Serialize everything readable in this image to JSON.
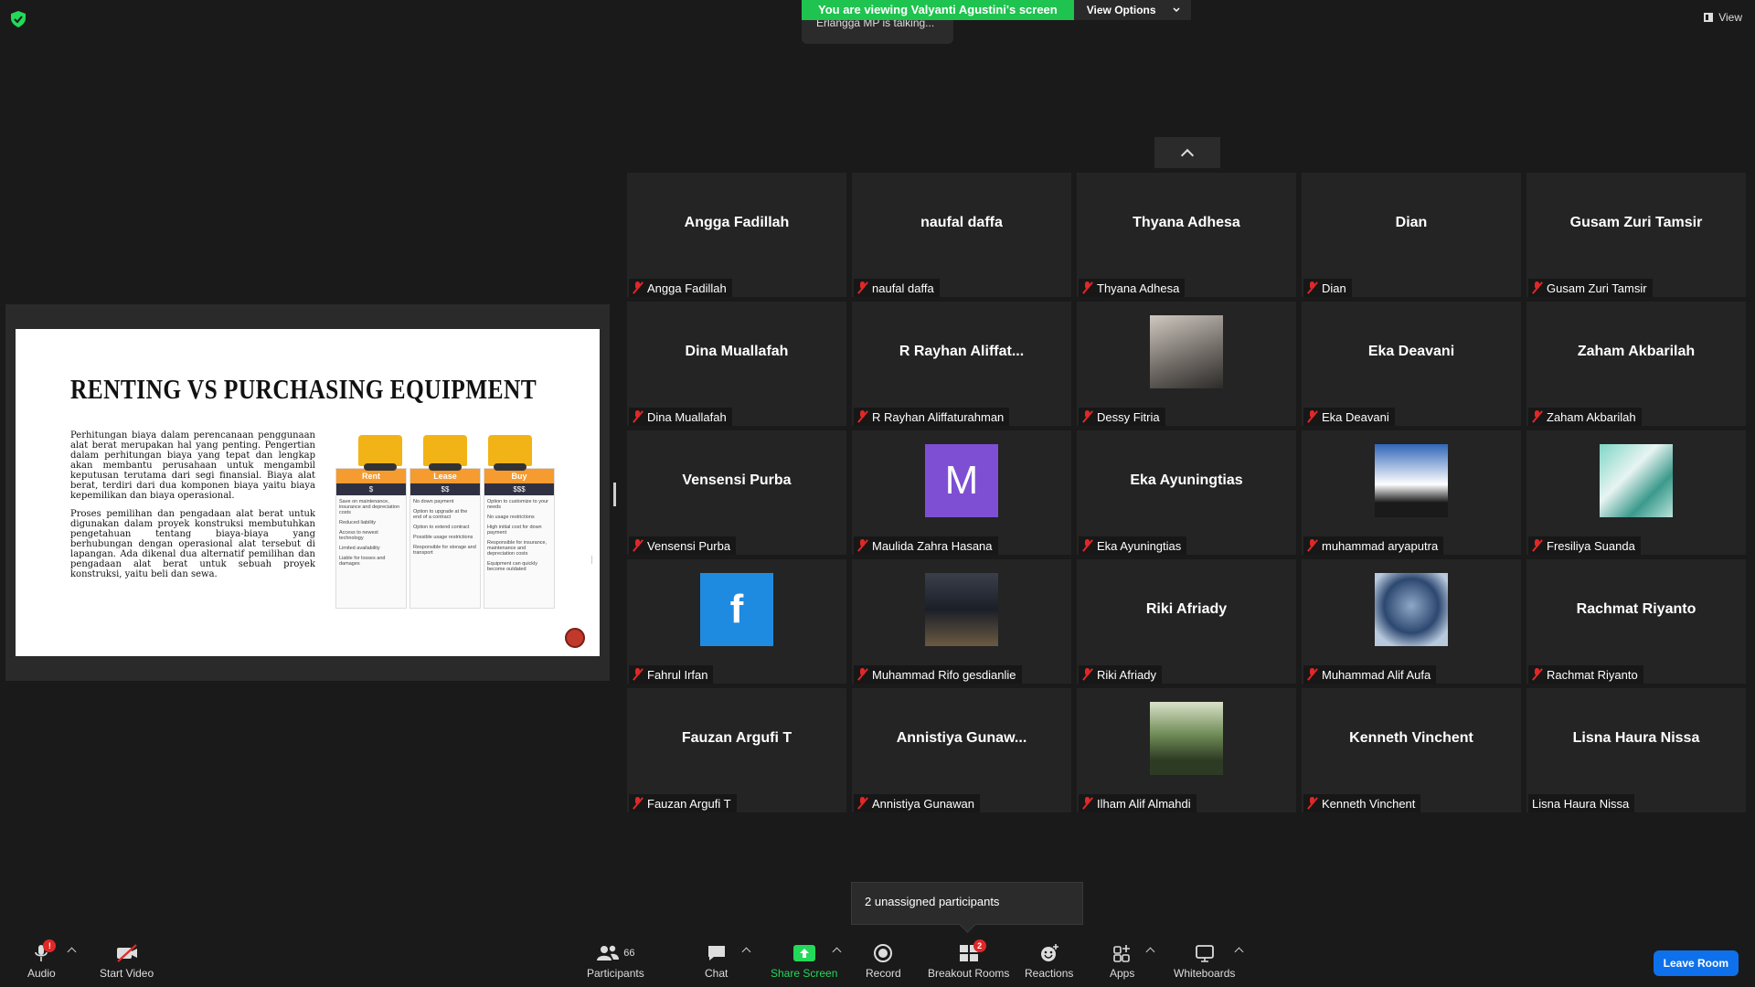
{
  "banner": {
    "viewing": "You are viewing Valyanti Agustini's screen",
    "view_options": "View Options",
    "talking": "Erlangga MP is talking...",
    "view_label": "View"
  },
  "slide": {
    "title": "RENTING VS PURCHASING EQUIPMENT",
    "para1": "Perhitungan biaya dalam perencanaan penggunaan alat berat merupakan hal yang penting. Pengertian dalam perhitungan biaya yang tepat dan lengkap akan membantu perusahaan untuk mengambil keputusan terutama dari segi finansial. Biaya alat berat, terdiri dari dua komponen biaya yaitu biaya kepemilikan dan biaya operasional.",
    "para2": "Proses pemilihan dan pengadaan alat berat untuk digunakan dalam proyek konstruksi membutuhkan pengetahuan tentang biaya-biaya yang berhubungan dengan operasional alat tersebut di lapangan. Ada dikenal dua alternatif pemilihan dan pengadaan alat berat untuk sebuah proyek konstruksi, yaitu beli dan sewa.",
    "columns": [
      {
        "head": "Rent",
        "cost": "$",
        "items": [
          "Save on maintenance, insurance and depreciation costs",
          "Reduced liability",
          "Access to newest technology",
          "Limited availability",
          "Liable for losses and damages"
        ]
      },
      {
        "head": "Lease",
        "cost": "$$",
        "items": [
          "No down payment",
          "Option to upgrade at the end of a contract",
          "Option to extend contract",
          "Possible usage restrictions",
          "Responsible for storage and transport"
        ]
      },
      {
        "head": "Buy",
        "cost": "$$$",
        "items": [
          "Option to customize to your needs",
          "No usage restrictions",
          "High initial cost for down payment",
          "Responsible for insurance, maintenance and depreciation costs",
          "Equipment can quickly become outdated"
        ]
      }
    ]
  },
  "participants_tiles": [
    {
      "big": "Angga Fadillah",
      "label": "Angga Fadillah",
      "muted": true
    },
    {
      "big": "naufal daffa",
      "label": "naufal daffa",
      "muted": true
    },
    {
      "big": "Thyana Adhesa",
      "label": "Thyana Adhesa",
      "muted": true
    },
    {
      "big": "Dian",
      "label": "Dian",
      "muted": true
    },
    {
      "big": "Gusam Zuri Tamsir",
      "label": "Gusam Zuri Tamsir",
      "muted": true
    },
    {
      "big": "Dina Muallafah",
      "label": "Dina Muallafah",
      "muted": true
    },
    {
      "big": "R Rayhan Aliffat...",
      "label": "R Rayhan Aliffaturahman",
      "muted": true
    },
    {
      "avatar": "photo1",
      "label": "Dessy Fitria",
      "muted": true
    },
    {
      "big": "Eka Deavani",
      "label": "Eka Deavani",
      "muted": true
    },
    {
      "big": "Zaham Akbarilah",
      "label": "Zaham Akbarilah",
      "muted": true
    },
    {
      "big": "Vensensi Purba",
      "label": "Vensensi Purba",
      "muted": true
    },
    {
      "avatar": "letter",
      "letter": "M",
      "label": "Maulida Zahra Hasana",
      "muted": true
    },
    {
      "big": "Eka Ayuningtias",
      "label": "Eka Ayuningtias",
      "muted": true
    },
    {
      "avatar": "photo2",
      "label": "muhammad aryaputra",
      "muted": true
    },
    {
      "avatar": "photo3",
      "label": "Fresiliya Suanda",
      "muted": true
    },
    {
      "avatar": "f",
      "letter": "f",
      "label": "Fahrul Irfan",
      "muted": true
    },
    {
      "avatar": "photo4",
      "label": "Muhammad Rifo gesdianlie",
      "muted": true
    },
    {
      "big": "Riki Afriady",
      "label": "Riki Afriady",
      "muted": true
    },
    {
      "avatar": "photo5",
      "label": "Muhammad Alif Aufa",
      "muted": true
    },
    {
      "big": "Rachmat Riyanto",
      "label": "Rachmat Riyanto",
      "muted": true
    },
    {
      "big": "Fauzan Argufi T",
      "label": "Fauzan Argufi T",
      "muted": true
    },
    {
      "big": "Annistiya  Gunaw...",
      "label": "Annistiya Gunawan",
      "muted": true
    },
    {
      "avatar": "photo6",
      "label": "Ilham Alif Almahdi",
      "muted": true
    },
    {
      "big": "Kenneth Vinchent",
      "label": "Kenneth Vinchent",
      "muted": true
    },
    {
      "big": "Lisna Haura Nissa",
      "label": "Lisna Haura Nissa",
      "muted": false
    }
  ],
  "popover": {
    "text": "2 unassigned participants"
  },
  "toolbar": {
    "audio": "Audio",
    "audio_badge": "!",
    "start_video": "Start Video",
    "participants": "Participants",
    "participants_count": "66",
    "chat": "Chat",
    "share_screen": "Share Screen",
    "record": "Record",
    "breakout_rooms": "Breakout Rooms",
    "breakout_badge": "2",
    "reactions": "Reactions",
    "apps": "Apps",
    "whiteboards": "Whiteboards",
    "leave": "Leave Room"
  },
  "colors": {
    "accent_green": "#23d959",
    "leave_blue": "#0e71eb",
    "muted_red": "#e02828"
  }
}
